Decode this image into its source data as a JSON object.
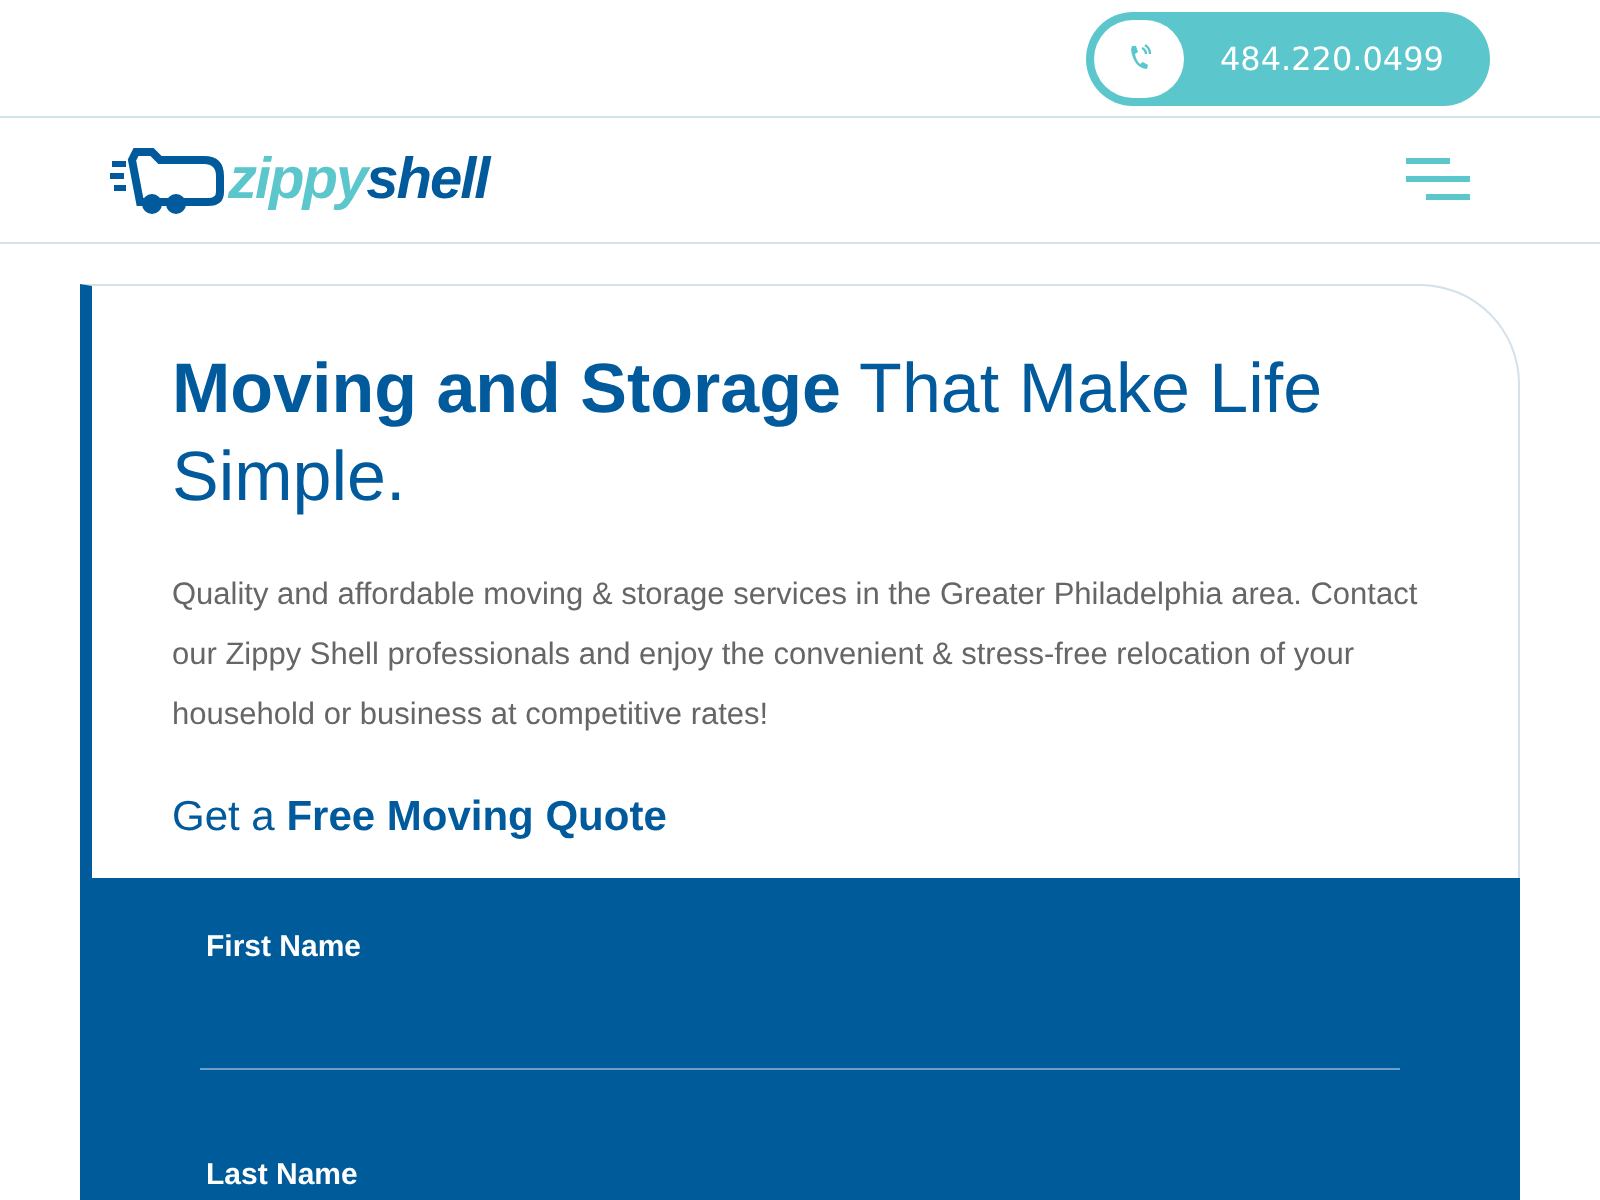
{
  "phone": {
    "number": "484.220.0499"
  },
  "logo": {
    "first": "zippy",
    "second": "shell"
  },
  "hero": {
    "heading": "**Moving and Storage** That Make Life Simple.",
    "text": "Quality and affordable moving & storage services in the Greater Philadelphia area. Contact our Zippy Shell professionals and enjoy the convenient & stress-free relocation of your household or business at competitive rates!",
    "quote_heading": "Get a **Free Moving Quote**"
  },
  "form": {
    "fields": [
      {
        "label": "First Name",
        "kind": "input"
      },
      {
        "label": "Last Name",
        "kind": "label"
      }
    ]
  }
}
